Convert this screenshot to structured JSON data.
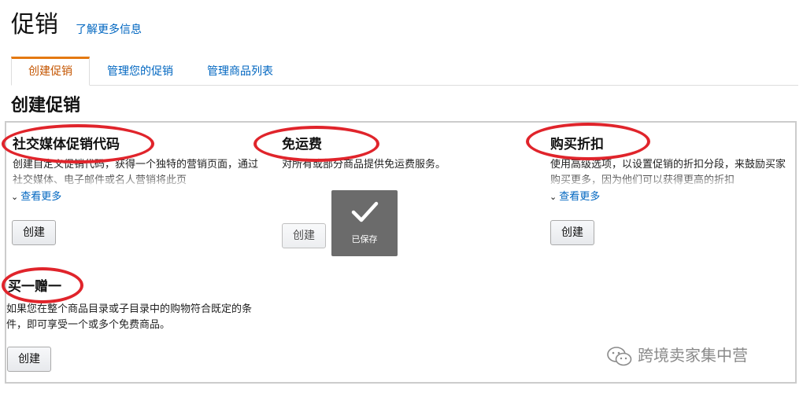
{
  "header": {
    "title": "促销",
    "learn_more": "了解更多信息"
  },
  "tabs": [
    {
      "label": "创建促销",
      "active": true
    },
    {
      "label": "管理您的促销",
      "active": false
    },
    {
      "label": "管理商品列表",
      "active": false
    }
  ],
  "section_title": "创建促销",
  "cards": {
    "social": {
      "title": "社交媒体促销代码",
      "desc": "创建自定义促销代码，获得一个独特的营销页面，通过社交媒体、电子邮件或名人营销将此页",
      "see_more": "查看更多",
      "button": "创建"
    },
    "free_shipping": {
      "title": "免运费",
      "desc": "对所有或部分商品提供免运费服务。",
      "button": "创建"
    },
    "discount": {
      "title": "购买折扣",
      "desc": "使用高级选项，以设置促销的折扣分段，来鼓励买家购买更多，因为他们可以获得更高的折扣",
      "see_more": "查看更多",
      "button": "创建"
    },
    "bogo": {
      "title": "买一赠一",
      "desc": "如果您在整个商品目录或子目录中的购物符合既定的条件，即可享受一个或多个免费商品。",
      "button": "创建"
    }
  },
  "toast": {
    "text": "已保存"
  },
  "watermark": "跨境卖家集中营",
  "colors": {
    "link": "#0066c0",
    "active_tab": "#c45500",
    "tab_accent": "#e47911",
    "highlight_ring": "#e0242b"
  }
}
